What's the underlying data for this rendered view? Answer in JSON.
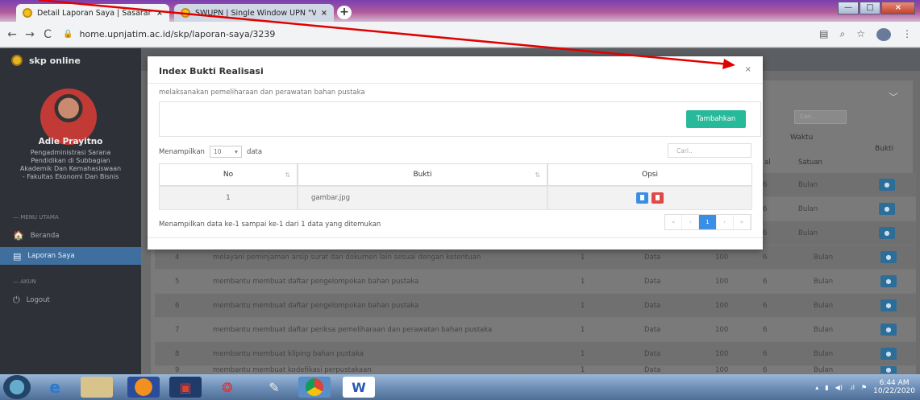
{
  "browser": {
    "tabs": [
      {
        "label": "Detail Laporan Saya | Sasaran Kir",
        "close": "×"
      },
      {
        "label": "SWUPN | Single Window UPN \"V",
        "close": "×"
      }
    ],
    "new_tab": "+",
    "url": "home.upnjatim.ac.id/skp/laporan-saya/3239",
    "nav": {
      "back": "←",
      "forward": "→",
      "reload": "C"
    },
    "window_buttons": {
      "minimize": "—",
      "maximize": "□",
      "close": "×"
    }
  },
  "app": {
    "brand": "skp online",
    "profile": {
      "name": "Adie Prayitno",
      "job": [
        "Pengadministrasi Sarana",
        "Pendidikan di Subbagian",
        "Akademik Dan Kemahasiswaan",
        "- Fakultas Ekonomi Dan Bisnis"
      ]
    },
    "menu": {
      "head_main": "— MENU UTAMA",
      "beranda": "Beranda",
      "laporan": "Laporan Saya",
      "head_akun": "— AKUN",
      "logout": "Logout"
    }
  },
  "background_table": {
    "search_placeholder": "Cari..",
    "headers": {
      "waktu": "Waktu",
      "satuan": "Satuan",
      "bukti": "Bukti",
      "partial": "al"
    },
    "side_rows": [
      {
        "num": "6",
        "unit": "Bulan"
      },
      {
        "num": "6",
        "unit": "Bulan"
      },
      {
        "num": "6",
        "unit": "Bulan"
      }
    ],
    "rows": [
      {
        "no": "4",
        "kegiatan": "melayani peminjaman arsip surat dan dokumen lain sesuai dengan ketentuan",
        "jumlah": "1",
        "satuan": "Data",
        "persen": "100",
        "waktu": "6",
        "unit": "Bulan"
      },
      {
        "no": "5",
        "kegiatan": "membantu membuat daftar pengelompokan bahan pustaka",
        "jumlah": "1",
        "satuan": "Data",
        "persen": "100",
        "waktu": "6",
        "unit": "Bulan"
      },
      {
        "no": "6",
        "kegiatan": "membantu membuat daftar pengelompokan bahan pustaka",
        "jumlah": "1",
        "satuan": "Data",
        "persen": "100",
        "waktu": "6",
        "unit": "Bulan"
      },
      {
        "no": "7",
        "kegiatan": "membantu membuat daftar periksa pemeliharaan dan perawatan bahan pustaka",
        "jumlah": "1",
        "satuan": "Data",
        "persen": "100",
        "waktu": "6",
        "unit": "Bulan"
      },
      {
        "no": "8",
        "kegiatan": "membantu membuat kliping bahan pustaka",
        "jumlah": "1",
        "satuan": "Data",
        "persen": "100",
        "waktu": "6",
        "unit": "Bulan"
      },
      {
        "no": "9",
        "kegiatan": "membantu membuat kodefikasi perpustakaan",
        "jumlah": "1",
        "satuan": "Data",
        "persen": "100",
        "waktu": "6",
        "unit": "Bulan"
      }
    ]
  },
  "modal": {
    "title": "Index Bukti Realisasi",
    "close": "×",
    "subtitle": "melaksanakan pemeliharaan dan perawatan bahan pustaka",
    "add_button": "Tambahkan",
    "show_prefix": "Menampilkan",
    "show_value": "10",
    "show_suffix": "data",
    "search_placeholder": "Cari..",
    "columns": {
      "no": "No",
      "bukti": "Bukti",
      "opsi": "Opsi"
    },
    "rows": [
      {
        "no": "1",
        "bukti": "gambar.jpg"
      }
    ],
    "info": "Menampilkan data ke-1 sampai ke-1 dari 1 data yang ditemukan",
    "pagination": [
      "«",
      "‹",
      "1",
      "›",
      "»"
    ]
  },
  "taskbar": {
    "time": "6:44 AM",
    "date": "10/22/2020"
  },
  "colors": {
    "accent": "#26b99a",
    "sidebar": "#2e3138",
    "active_menu": "#3e6f9e",
    "annotation_arrow": "#e00000"
  }
}
